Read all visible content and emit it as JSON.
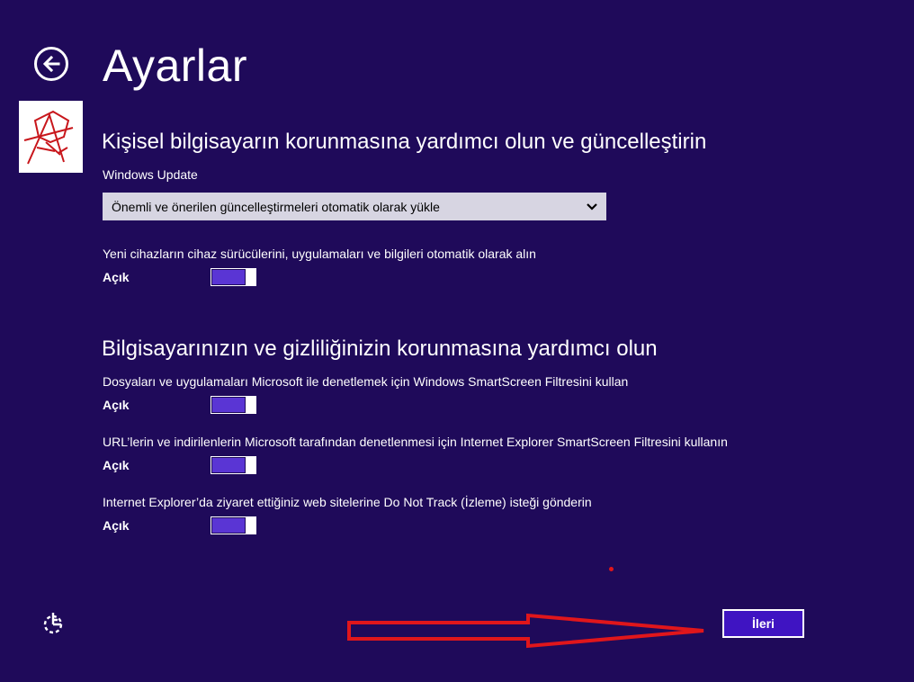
{
  "header": {
    "title": "Ayarlar"
  },
  "section1": {
    "title": "Kişisel bilgisayarın korunmasına yardımcı olun ve güncelleştirin",
    "windows_update_label": "Windows Update",
    "windows_update_value": "Önemli ve önerilen güncelleştirmeleri otomatik olarak yükle",
    "drivers_label": "Yeni cihazların cihaz sürücülerini, uygulamaları ve bilgileri otomatik olarak alın",
    "drivers_state": "Açık"
  },
  "section2": {
    "title": "Bilgisayarınızın ve gizliliğinizin korunmasına yardımcı olun",
    "smartscreen_label": "Dosyaları ve uygulamaları Microsoft ile denetlemek için Windows SmartScreen Filtresini kullan",
    "smartscreen_state": "Açık",
    "ie_smartscreen_label": "URL’lerin ve indirilenlerin Microsoft tarafından denetlenmesi için Internet Explorer SmartScreen Filtresini kullanın",
    "ie_smartscreen_state": "Açık",
    "dnt_label": "Internet Explorer’da ziyaret ettiğiniz web sitelerine Do Not Track (İzleme) isteği gönderin",
    "dnt_state": "Açık"
  },
  "footer": {
    "next_label": "İleri"
  },
  "icons": {
    "back": "back-arrow-icon",
    "ease_of_access": "ease-of-access-icon",
    "dropdown": "chevron-down-icon"
  },
  "colors": {
    "background": "#1f0a5a",
    "toggle_on": "#5a35d4",
    "next_button": "#3f14c2",
    "annotation": "#e0161b"
  }
}
